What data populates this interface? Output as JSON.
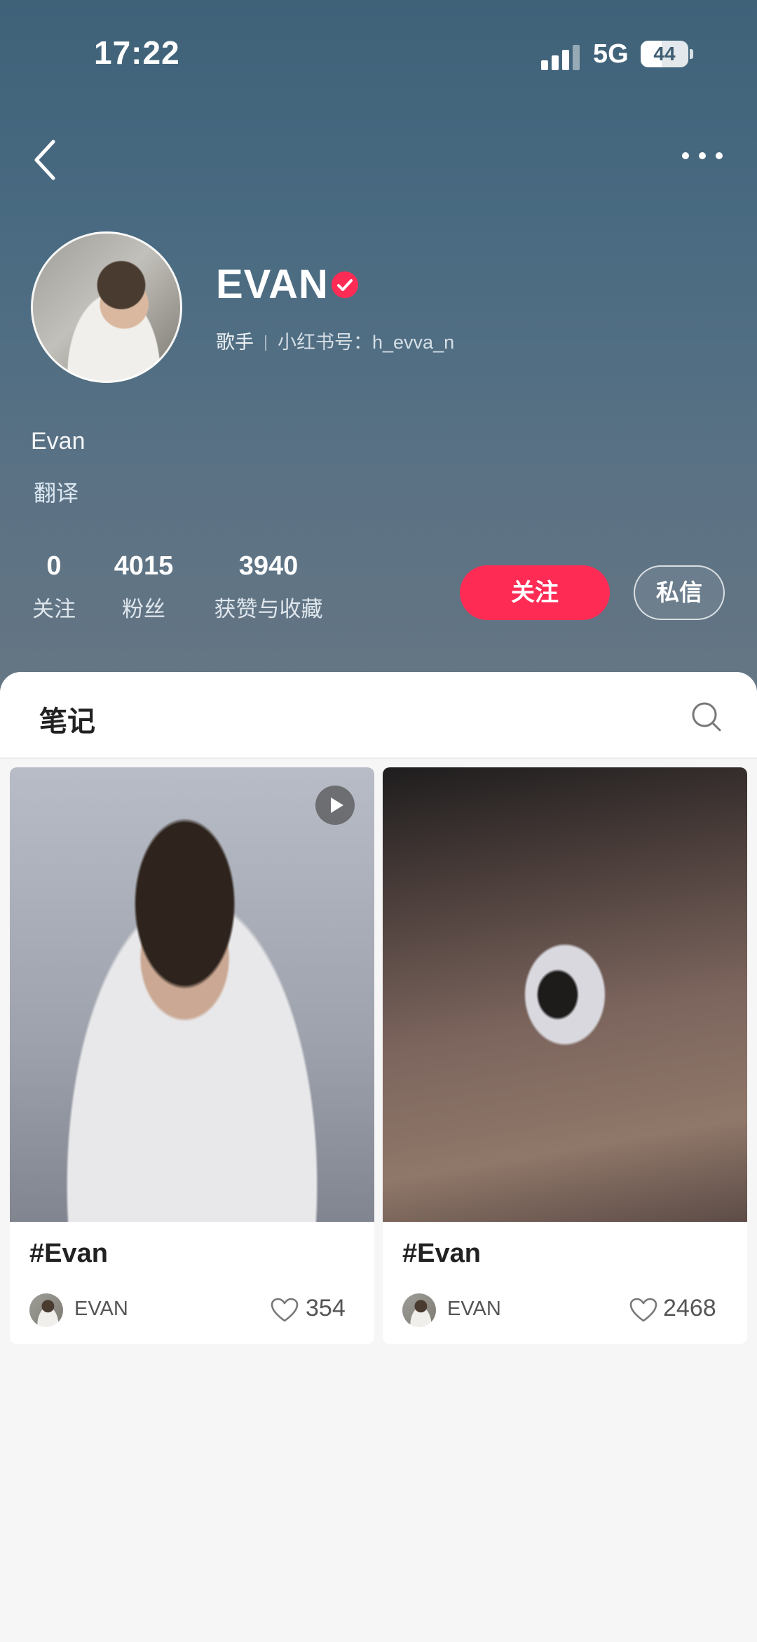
{
  "status_bar": {
    "time": "17:22",
    "network": "5G",
    "battery": "44"
  },
  "nav": {
    "back_icon": "chevron-left-icon",
    "more_icon": "more-dots-icon"
  },
  "profile": {
    "name": "EVAN",
    "verified_color": "#fe2c55",
    "role": "歌手",
    "red_id": "小红书号：h_evva_n",
    "description": "Evan",
    "translate_label": "翻译"
  },
  "stats": [
    {
      "value": "0",
      "label": "关注"
    },
    {
      "value": "4015",
      "label": "粉丝"
    },
    {
      "value": "3940",
      "label": "获赞与收藏"
    }
  ],
  "actions": {
    "follow_label": "关注",
    "message_label": "私信",
    "accent": "#fe2c55"
  },
  "tabs": {
    "notes_label": "笔记",
    "search_icon": "search-icon"
  },
  "notes": [
    {
      "title": "#Evan",
      "author": "EVAN",
      "likes": "354",
      "is_video": true
    },
    {
      "title": "#Evan",
      "author": "EVAN",
      "likes": "2468",
      "is_video": false
    }
  ]
}
